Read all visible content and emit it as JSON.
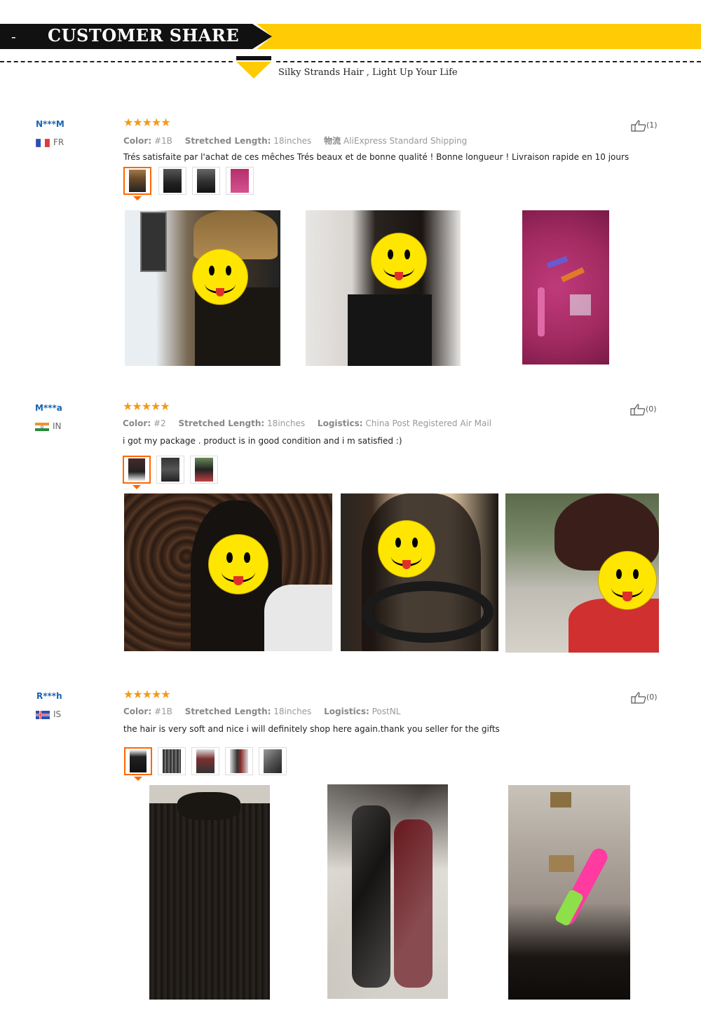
{
  "header": {
    "dash_mark": "-",
    "title": "CUSTOMER SHARE",
    "subtitle": "Silky Strands Hair , Light Up Your Life"
  },
  "colors": {
    "accent_yellow": "#ffcb05",
    "dark": "#111111",
    "star": "#f29a1a",
    "user_link": "#1a63b5",
    "selected_thumb": "#ff6600"
  },
  "reviews": [
    {
      "user": "N***M",
      "country": "FR",
      "rating": 5,
      "stars_text": "★★★★★",
      "props": [
        {
          "label": "Color:",
          "value": "#1B"
        },
        {
          "label": "Stretched Length:",
          "value": "18inches"
        },
        {
          "label": "物流",
          "value": "AliExpress Standard Shipping"
        }
      ],
      "text": "Trés satisfaite par l'achat de ces mêches Trés beaux et de bonne qualité ! Bonne longueur ! Livraison rapide en 10 jours",
      "likes": "(1)",
      "thumbnail_count": 4,
      "photo_count": 3
    },
    {
      "user": "M***a",
      "country": "IN",
      "rating": 5,
      "stars_text": "★★★★★",
      "props": [
        {
          "label": "Color:",
          "value": "#2"
        },
        {
          "label": "Stretched Length:",
          "value": "18inches"
        },
        {
          "label": "Logistics:",
          "value": "China Post Registered Air Mail"
        }
      ],
      "text": "i got my package . product is in good condition and i m satisfied :)",
      "likes": "(0)",
      "thumbnail_count": 3,
      "photo_count": 3
    },
    {
      "user": "R***h",
      "country": "IS",
      "rating": 5,
      "stars_text": "★★★★★",
      "props": [
        {
          "label": "Color:",
          "value": "#1B"
        },
        {
          "label": "Stretched Length:",
          "value": "18inches"
        },
        {
          "label": "Logistics:",
          "value": "PostNL"
        }
      ],
      "text": "the hair is very soft and nice i will definitely shop here again.thank you seller for the gifts",
      "likes": "(0)",
      "thumbnail_count": 5,
      "photo_count": 3
    }
  ]
}
